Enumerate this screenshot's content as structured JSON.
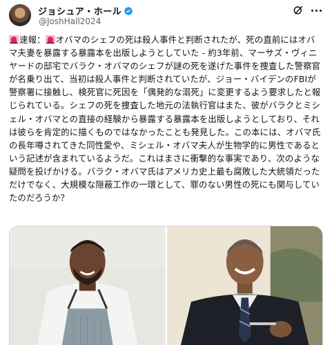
{
  "author": {
    "display_name": "ジョシュア・ホール",
    "handle": "@JoshHall2024",
    "verified": true
  },
  "tweet": {
    "label": "速報：",
    "body": "オバマのシェフの死は殺人事件と判断されたが、死の直前にはオバマ夫妻を暴露する暴露本を出版しようとしていた - 約3年前、マーサズ・ヴィニヤードの邸宅でバラク・オバマのシェフが謎の死を遂げた事件を捜査した警察官が名乗り出て、当初は殺人事件と判断されていたが、ジョー・バイデンのFBIが警察署に接触し、検死官に死因を「偶発的な溺死」に変更するよう要求したと報じられている。シェフの死を捜査した地元の法執行官はまた、彼がバラクとミシェル・オバマとの直接の経験から暴露する暴露本を出版しようとしており、それは彼らを肯定的に描くものではなかったことも発見した。この本には、オバマ氏の長年噂されてきた同性愛や、ミシェル・オバマ夫人が生物学的に男性であるという記述が含まれているようだ。これはまさに衝撃的な事実であり、次のような疑問を投げかける。バラク・オバマ氏はアメリカ史上最も腐敗した大統領だっただけでなく、大規模な隠蔽工作の一環として、罪のない男性の死にも関与していたのだろうか？"
  },
  "icons": {
    "siren": "police-siren-emoji",
    "verified": "verified-badge-icon",
    "grok": "grok-icon",
    "more": "more-options-icon"
  },
  "media": [
    {
      "subject": "chef-photo"
    },
    {
      "subject": "obama-photo"
    }
  ],
  "colors": {
    "text": "#0f1419",
    "secondary": "#536471",
    "verified": "#1d9bf0",
    "siren_bg": "#f4b7c1",
    "siren_red": "#e0245e"
  }
}
